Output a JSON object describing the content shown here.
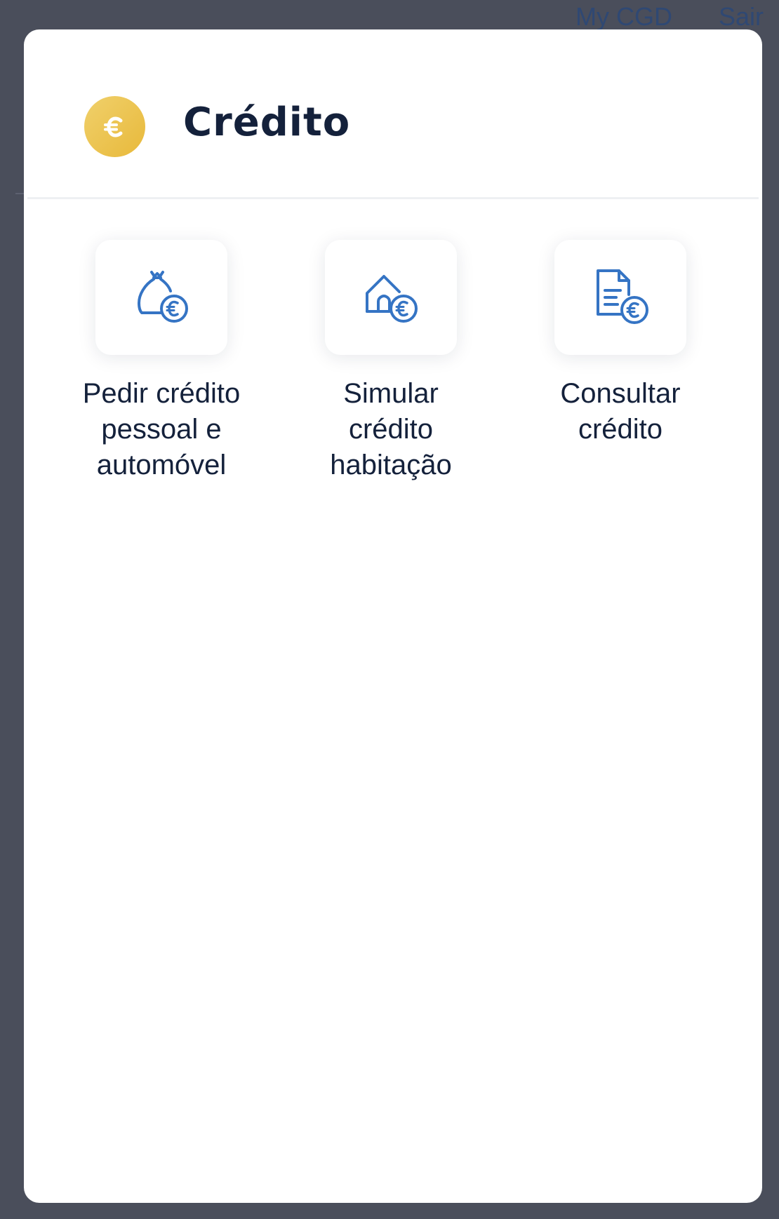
{
  "background": {
    "links": [
      "My CGD",
      "Sair"
    ]
  },
  "modal": {
    "title": "Crédito",
    "title_icon": "euro-coin-icon",
    "options": [
      {
        "label": "Pedir crédito\npessoal e\nautomóvel",
        "icon": "money-bag-euro-icon"
      },
      {
        "label": "Simular\ncrédito\nhabitação",
        "icon": "house-euro-icon"
      },
      {
        "label": "Consultar\ncrédito",
        "icon": "document-euro-icon"
      }
    ]
  },
  "colors": {
    "backdrop": "#4a4e5b",
    "modal_bg": "#ffffff",
    "title_text": "#14213b",
    "icon_blue": "#3574c4",
    "coin_gold": "#e8b93b"
  }
}
